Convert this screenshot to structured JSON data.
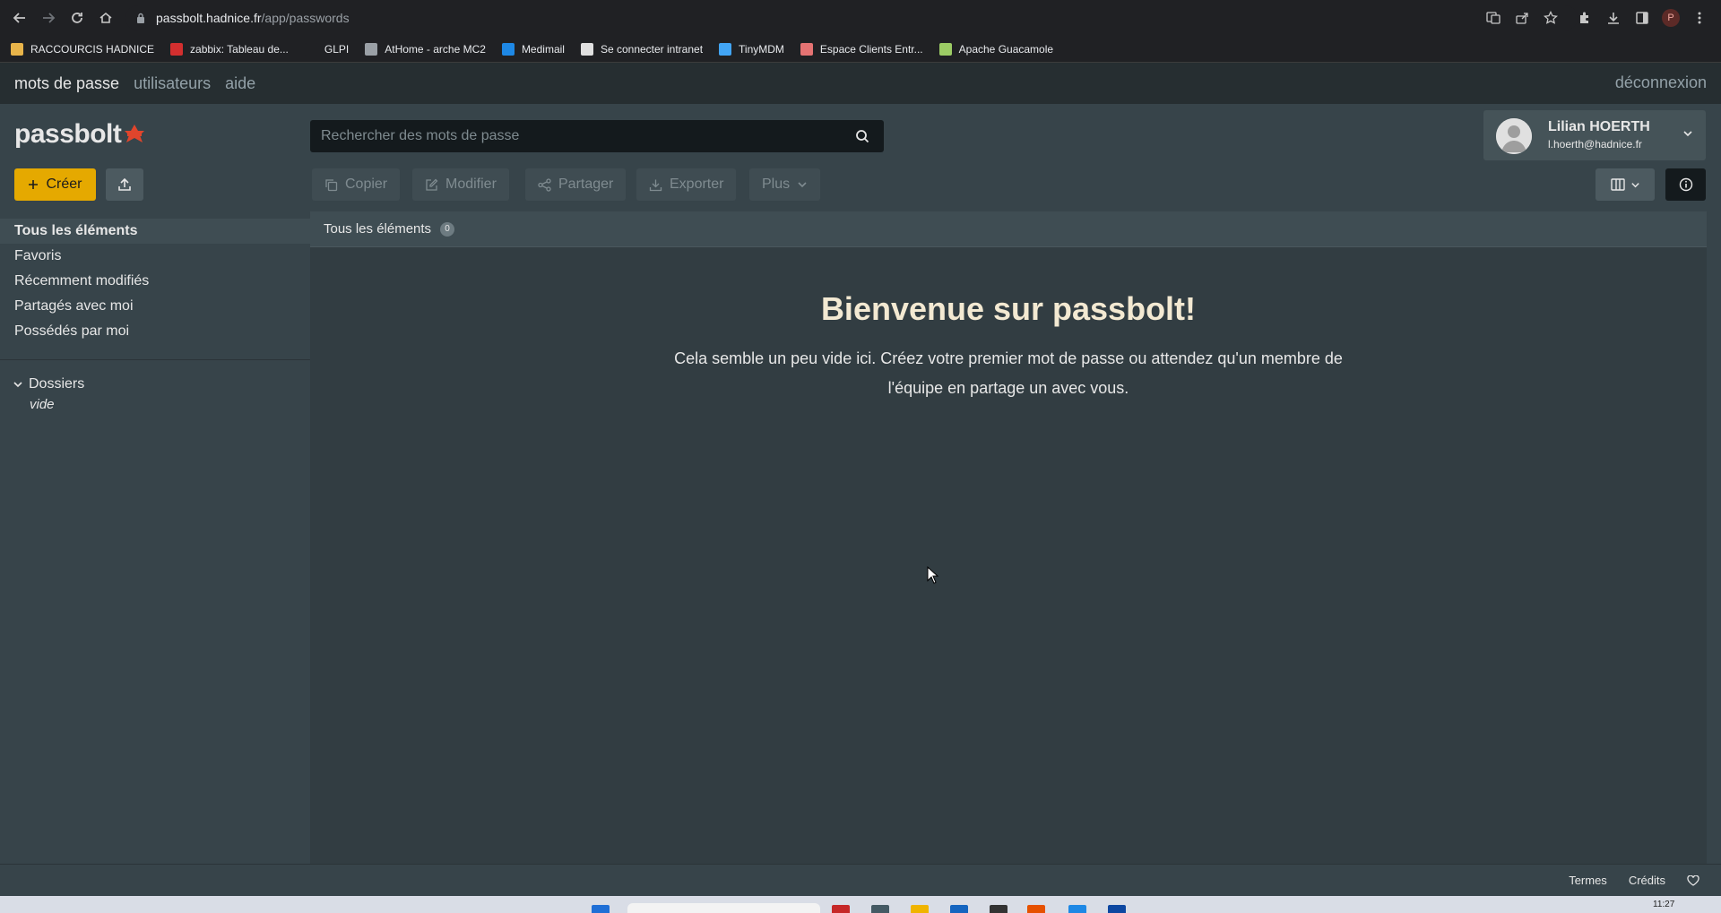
{
  "browser": {
    "url_host": "passbolt.hadnice.fr",
    "url_path": "/app/passwords",
    "bookmarks": [
      {
        "label": "RACCOURCIS HADNICE",
        "icon": "folder-icon",
        "color": "#e8b44a"
      },
      {
        "label": "zabbix: Tableau de...",
        "icon": "zabbix-icon",
        "color": "#d32f2f"
      },
      {
        "label": "GLPI",
        "icon": "glpi-icon",
        "color": "#202124"
      },
      {
        "label": "AtHome - arche MC2",
        "icon": "globe-icon",
        "color": "#9aa0a6"
      },
      {
        "label": "Medimail",
        "icon": "medimail-icon",
        "color": "#1e88e5"
      },
      {
        "label": "Se connecter intranet",
        "icon": "intranet-icon",
        "color": "#e0e0e0"
      },
      {
        "label": "TinyMDM",
        "icon": "tinymdm-icon",
        "color": "#42a5f5"
      },
      {
        "label": "Espace Clients Entr...",
        "icon": "espace-clients-icon",
        "color": "#e57373"
      },
      {
        "label": "Apache Guacamole",
        "icon": "guacamole-icon",
        "color": "#9ccc65"
      }
    ],
    "profile_initial": "P"
  },
  "menu": {
    "passwords": "mots de passe",
    "users": "utilisateurs",
    "help": "aide",
    "logout": "déconnexion"
  },
  "header": {
    "logo": "passbolt",
    "search_placeholder": "Rechercher des mots de passe",
    "user_name": "Lilian HOERTH",
    "user_email": "l.hoerth@hadnice.fr"
  },
  "actions": {
    "create": "Créer",
    "copy": "Copier",
    "edit": "Modifier",
    "share": "Partager",
    "export": "Exporter",
    "more": "Plus"
  },
  "sidebar": {
    "filters": [
      {
        "label": "Tous les éléments"
      },
      {
        "label": "Favoris"
      },
      {
        "label": "Récemment modifiés"
      },
      {
        "label": "Partagés avec moi"
      },
      {
        "label": "Possédés par moi"
      }
    ],
    "folders_title": "Dossiers",
    "folders_empty": "vide"
  },
  "main": {
    "breadcrumb": "Tous les éléments",
    "count": "0",
    "welcome_title": "Bienvenue sur passbolt!",
    "welcome_text": "Cela semble un peu vide ici. Créez votre premier mot de passe ou attendez qu'un membre de l'équipe en partage un avec vous."
  },
  "footer": {
    "terms": "Termes",
    "credits": "Crédits"
  },
  "taskbar": {
    "clock": "11:27"
  },
  "colors": {
    "accent": "#e5a900",
    "brand_red": "#e0452c",
    "background": "#323d42",
    "panel": "#37444a"
  }
}
